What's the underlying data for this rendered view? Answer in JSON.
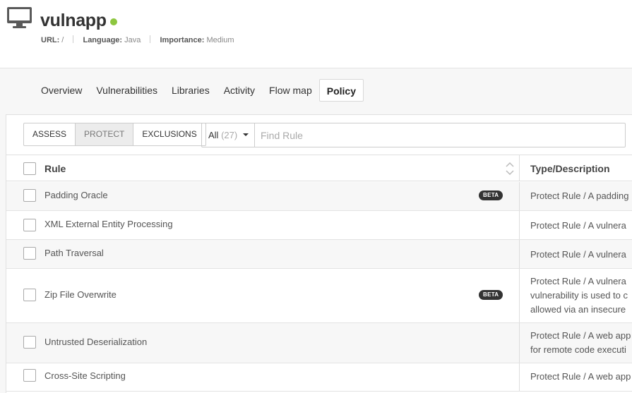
{
  "app": {
    "name": "vulnapp",
    "status_color": "#8dc63f",
    "meta": [
      {
        "key": "URL:",
        "value": "/"
      },
      {
        "key": "Language:",
        "value": "Java"
      },
      {
        "key": "Importance:",
        "value": "Medium"
      }
    ]
  },
  "tabs": [
    {
      "label": "Overview"
    },
    {
      "label": "Vulnerabilities"
    },
    {
      "label": "Libraries"
    },
    {
      "label": "Activity"
    },
    {
      "label": "Flow map"
    },
    {
      "label": "Policy",
      "active": true
    }
  ],
  "toolbar": {
    "segments": [
      {
        "label": "ASSESS"
      },
      {
        "label": "PROTECT",
        "active": true
      },
      {
        "label": "EXCLUSIONS"
      }
    ],
    "filter_label": "All",
    "filter_count": "(27)",
    "search_placeholder": "Find Rule"
  },
  "table": {
    "columns": {
      "rule": "Rule",
      "type": "Type/Description"
    },
    "rows": [
      {
        "name": "Padding Oracle",
        "beta": "BETA",
        "desc": [
          "Protect Rule / A padding"
        ]
      },
      {
        "name": "XML External Entity Processing",
        "beta": "",
        "desc": [
          "Protect Rule / A vulnera"
        ]
      },
      {
        "name": "Path Traversal",
        "beta": "",
        "desc": [
          "Protect Rule / A vulnera"
        ]
      },
      {
        "name": "Zip File Overwrite",
        "beta": "BETA",
        "desc": [
          "Protect Rule / A vulnera",
          "vulnerability is used to c",
          "allowed via an insecure"
        ]
      },
      {
        "name": "Untrusted Deserialization",
        "beta": "",
        "desc": [
          "Protect Rule / A web app",
          "for remote code executi"
        ]
      },
      {
        "name": "Cross-Site Scripting",
        "beta": "",
        "desc": [
          "Protect Rule / A web app"
        ]
      }
    ]
  }
}
